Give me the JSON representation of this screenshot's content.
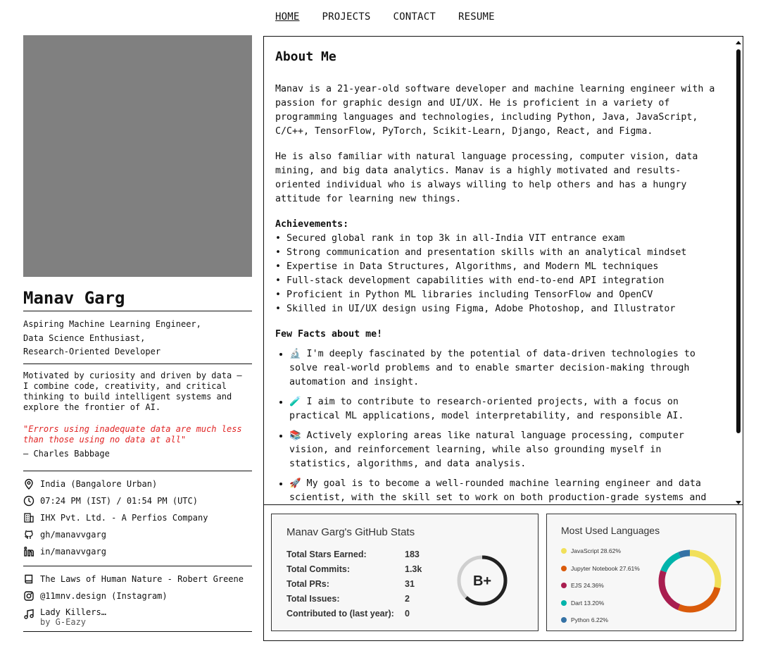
{
  "nav": {
    "items": [
      {
        "label": "HOME",
        "active": true
      },
      {
        "label": "PROJECTS",
        "active": false
      },
      {
        "label": "CONTACT",
        "active": false
      },
      {
        "label": "RESUME",
        "active": false
      }
    ]
  },
  "profile": {
    "name": "Manav Garg",
    "roles": [
      "Aspiring Machine Learning Engineer,",
      "Data Science Enthusiast,",
      "Research-Oriented Developer"
    ],
    "bio": "Motivated by curiosity and driven by data — I combine code, creativity, and critical thinking to build intelligent systems and explore the frontier of AI.",
    "quote": "\"Errors using inadequate data are much less than those using no data at all\"",
    "quote_author": "— Charles Babbage",
    "location": "India (Bangalore Urban)",
    "time": "07:24 PM (IST) / 01:54 PM (UTC)",
    "company": "IHX Pvt. Ltd. - A Perfios Company",
    "github": "gh/manavvgarg",
    "linkedin": "in/manavvgarg",
    "book": "The Laws of Human Nature - Robert Greene",
    "instagram": "@11mnv.design (Instagram)",
    "song_title": "Lady Killers…",
    "song_artist": "by G-Eazy"
  },
  "about": {
    "heading": "About Me",
    "para1": "Manav is a 21-year-old software developer and machine learning engineer with a passion for graphic design and UI/UX. He is proficient in a variety of programming languages and technologies, including Python, Java, JavaScript, C/C++, TensorFlow, PyTorch, Scikit-Learn, Django, React, and Figma.",
    "para2": "He is also familiar with natural language processing, computer vision, data mining, and big data analytics. Manav is a highly motivated and results-oriented individual who is always willing to help others and has a hungry attitude for learning new things.",
    "achievements_title": "Achievements:",
    "achievements": [
      "• Secured global rank in top 3k in all-India VIT entrance exam",
      "• Strong communication and presentation skills with an analytical mindset",
      "• Expertise in Data Structures, Algorithms, and Modern ML techniques",
      "• Full-stack development capabilities with end-to-end API integration",
      "• Proficient in Python ML libraries including TensorFlow and OpenCV",
      "• Skilled in UI/UX design using Figma, Adobe Photoshop, and Illustrator"
    ],
    "facts_title": "Few Facts about me!",
    "facts": [
      "🔬 I'm deeply fascinated by the potential of data-driven technologies to solve real-world problems and to enable smarter decision-making through automation and insight.",
      "🧪 I aim to contribute to research-oriented projects, with a focus on practical ML applications, model interpretability, and responsible AI.",
      "📚 Actively exploring areas like natural language processing, computer vision, and reinforcement learning, while also grounding myself in statistics, algorithms, and data analysis.",
      "🚀 My goal is to become a well-rounded machine learning engineer and data scientist, with the skill set to work on both production-grade systems and research."
    ]
  },
  "github_stats": {
    "title": "Manav Garg's GitHub Stats",
    "rows": [
      {
        "label": "Total Stars Earned:",
        "value": "183"
      },
      {
        "label": "Total Commits:",
        "value": "1.3k"
      },
      {
        "label": "Total PRs:",
        "value": "31"
      },
      {
        "label": "Total Issues:",
        "value": "2"
      },
      {
        "label": "Contributed to (last year):",
        "value": "0"
      }
    ],
    "grade": "B+",
    "grade_progress": 0.62
  },
  "languages": {
    "title": "Most Used Languages",
    "items": [
      {
        "label": "JavaScript 28.62%",
        "value": 28.62,
        "color": "#f1e05a"
      },
      {
        "label": "Jupyter Notebook 27.61%",
        "value": 27.61,
        "color": "#DA5B0B"
      },
      {
        "label": "EJS 24.36%",
        "value": 24.36,
        "color": "#a91e50"
      },
      {
        "label": "Dart 13.20%",
        "value": 13.2,
        "color": "#00B4AB"
      },
      {
        "label": "Python 6.22%",
        "value": 6.22,
        "color": "#3572A5"
      }
    ]
  }
}
